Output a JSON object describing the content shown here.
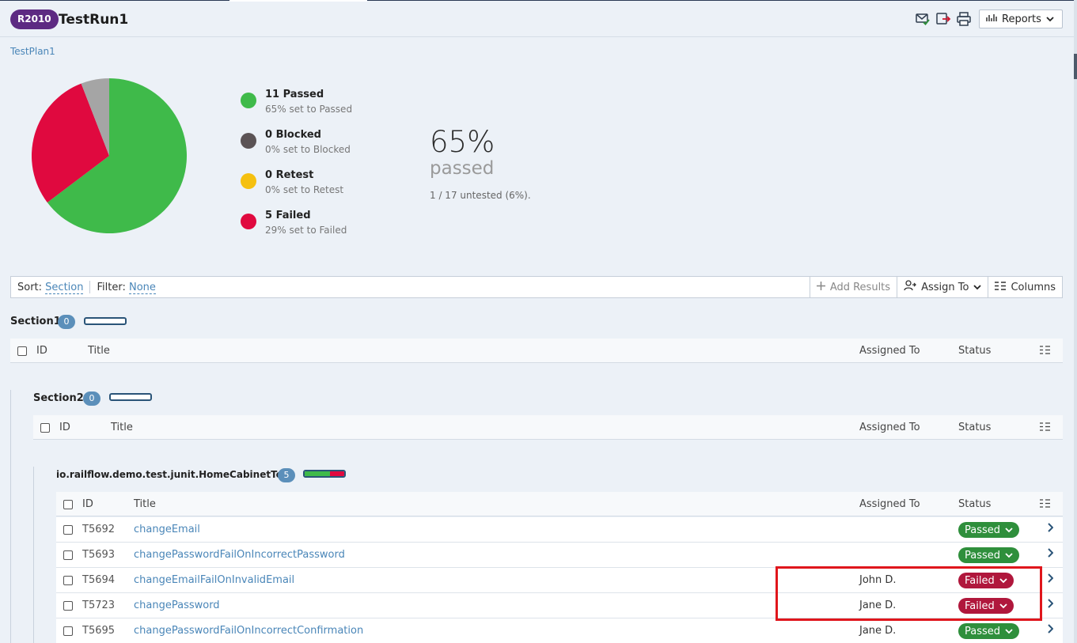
{
  "header": {
    "badge": "R2010",
    "title": "TestRun1",
    "reports_label": "Reports"
  },
  "breadcrumb": {
    "plan": "TestPlan1"
  },
  "summary": {
    "legend": [
      {
        "title": "11 Passed",
        "sub": "65% set to Passed",
        "color": "#3fba4a"
      },
      {
        "title": "0 Blocked",
        "sub": "0% set to Blocked",
        "color": "#5b5355"
      },
      {
        "title": "0 Retest",
        "sub": "0% set to Retest",
        "color": "#f5c010"
      },
      {
        "title": "5 Failed",
        "sub": "29% set to Failed",
        "color": "#e0093f"
      }
    ],
    "percent": "65%",
    "percent_word": "passed",
    "untested": "1 / 17 untested (6%)."
  },
  "chart_data": {
    "type": "pie",
    "categories": [
      "Passed",
      "Blocked",
      "Retest",
      "Failed",
      "Untested"
    ],
    "values": [
      11,
      0,
      0,
      5,
      1
    ],
    "colors": [
      "#3fba4a",
      "#5b5355",
      "#f5c010",
      "#e0093f",
      "#a5a5a5"
    ]
  },
  "toolbar": {
    "sort_label": "Sort:",
    "sort_value": "Section",
    "filter_label": "Filter:",
    "filter_value": "None",
    "add_results": "Add Results",
    "assign_to": "Assign To",
    "columns": "Columns"
  },
  "columns": {
    "id": "ID",
    "title": "Title",
    "assigned": "Assigned To",
    "status": "Status"
  },
  "sections": [
    {
      "name": "Section1",
      "count": "0"
    },
    {
      "name": "Section2",
      "count": "0"
    },
    {
      "name": "io.railflow.demo.test.junit.HomeCabinetTest",
      "count": "5"
    }
  ],
  "rows": [
    {
      "id": "T5692",
      "title": "changeEmail",
      "assigned": "",
      "status": "Passed",
      "status_kind": "passed"
    },
    {
      "id": "T5693",
      "title": "changePasswordFailOnIncorrectPassword",
      "assigned": "",
      "status": "Passed",
      "status_kind": "passed"
    },
    {
      "id": "T5694",
      "title": "changeEmailFailOnInvalidEmail",
      "assigned": "John D.",
      "status": "Failed",
      "status_kind": "failed"
    },
    {
      "id": "T5723",
      "title": "changePassword",
      "assigned": "Jane D.",
      "status": "Failed",
      "status_kind": "failed"
    },
    {
      "id": "T5695",
      "title": "changePasswordFailOnIncorrectConfirmation",
      "assigned": "Jane D.",
      "status": "Passed",
      "status_kind": "passed"
    }
  ]
}
